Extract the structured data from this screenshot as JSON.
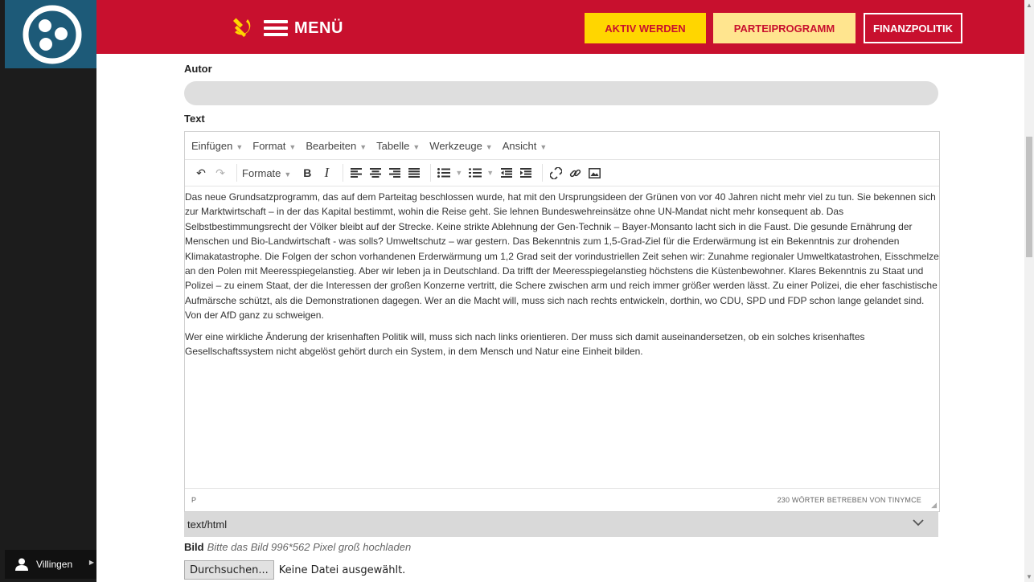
{
  "header": {
    "menu_label": "MENÜ",
    "buttons": {
      "aktiv": "AKTIV WERDEN",
      "partei": "PARTEIPROGRAMM",
      "finanz": "FINANZPOLITIK"
    },
    "colors": {
      "bar": "#c8102e",
      "yellow": "#ffd600"
    }
  },
  "sidebar": {
    "user_name": "Villingen"
  },
  "form": {
    "autor_label": "Autor",
    "text_label": "Text",
    "editor": {
      "menu": [
        "Einfügen",
        "Format",
        "Bearbeiten",
        "Tabelle",
        "Werkzeuge",
        "Ansicht"
      ],
      "formate_label": "Formate",
      "paragraphs": [
        "Das neue Grundsatzprogramm, das auf dem Parteitag beschlossen wurde, hat mit den Ursprungsideen der Grünen von vor 40 Jahren nicht mehr viel zu tun. Sie bekennen sich zur Marktwirtschaft – in der das Kapital bestimmt, wohin die Reise geht. Sie lehnen Bundeswehreinsätze ohne UN-Mandat nicht mehr konsequent ab. Das Selbstbestimmungsrecht der Völker bleibt auf der Strecke. Keine strikte Ablehnung der Gen-Technik – Bayer-Monsanto lacht sich in die Faust. Die gesunde Ernährung der Menschen und Bio-Landwirtschaft - was solls? Umweltschutz – war gestern. Das Bekenntnis zum 1,5-Grad-Ziel für die Erderwärmung ist ein Bekenntnis zur drohenden Klimakatastrophe. Die Folgen der schon vorhandenen Erderwärmung um 1,2 Grad seit der vorindustriellen Zeit sehen wir: Zunahme regionaler Umweltkatastrohen, Eisschmelze an den Polen mit Meeresspiegelanstieg. Aber wir leben ja in Deutschland. Da trifft der Meeresspiegelanstieg höchstens die Küstenbewohner. Klares Bekenntnis zu Staat und Polizei – zu einem Staat, der die Interessen der großen Konzerne vertritt, die Schere zwischen arm und reich immer größer werden lässt. Zu einer Polizei, die eher faschistische Aufmärsche schützt, als die Demonstrationen dagegen. Wer an die Macht will, muss sich nach rechts entwickeln, dorthin, wo CDU, SPD und FDP schon lange gelandet sind. Von der AfD ganz zu schweigen.",
        "Wer eine wirkliche Änderung der krisenhaften Politik will, muss sich nach links orientieren. Der muss sich damit auseinandersetzen, ob ein solches krisenhaftes Gesellschaftssystem nicht abgelöst gehört durch ein System, in dem Mensch und Natur eine Einheit bilden."
      ],
      "status_path": "P",
      "status_words": "230 WÖRTER BETREBEN VON TINYMCE"
    },
    "format_value": "text/html",
    "bild_label": "Bild",
    "bild_hint": "Bitte das Bild 996*562 Pixel groß hochladen",
    "browse_label": "Durchsuchen...",
    "file_state": "Keine Datei ausgewählt."
  }
}
